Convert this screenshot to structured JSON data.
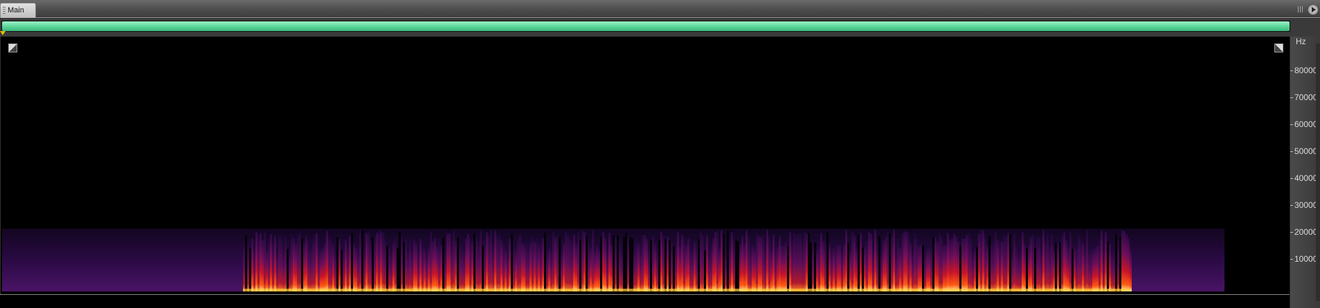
{
  "tab": {
    "label": "Main"
  },
  "overview": {
    "fill_fraction": 1.0,
    "fill_color": "#5fd89c"
  },
  "ruler": {
    "unit": "Hz",
    "ticks": [
      "80000",
      "70000",
      "60000",
      "50000",
      "40000",
      "30000",
      "20000",
      "10000"
    ]
  },
  "colors": {
    "background": "#000000",
    "spectrum_low": "#3a0a5a",
    "spectrum_mid": "#e01818",
    "spectrum_high": "#fff8a0"
  }
}
